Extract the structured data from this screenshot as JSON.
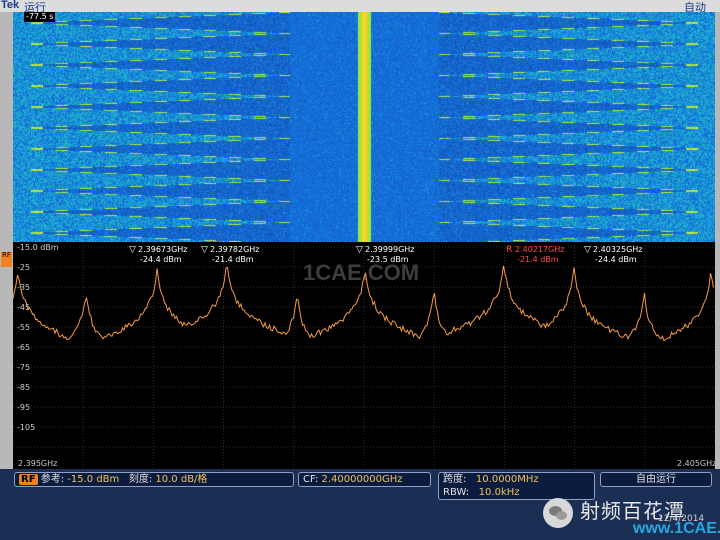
{
  "header": {
    "brand": "Tek",
    "run_state": "运行",
    "mode": "自动"
  },
  "waterfall": {
    "time_label": "-77.5 s"
  },
  "markers": [
    {
      "freq": "2.39673GHz",
      "level": "-24.4 dBm",
      "ref": false
    },
    {
      "freq": "2.39782GHz",
      "level": "-21.4 dBm",
      "ref": false
    },
    {
      "freq": "2.39999GHz",
      "level": "-23.5 dBm",
      "ref": false
    },
    {
      "freq": "2.40217GHz",
      "level": "-21.4 dBm",
      "ref": true
    },
    {
      "freq": "2.40325GHz",
      "level": "-24.4 dBm",
      "ref": false
    }
  ],
  "spectrum": {
    "y_tick_labels": [
      "-15.0 dBm",
      "-25",
      "-35",
      "-45",
      "-55",
      "-65",
      "-75",
      "-85",
      "-95",
      "-105"
    ],
    "x_start": "2.395GHz",
    "x_end": "2.405GHz",
    "watermark": "1CAE.COM",
    "trace_color": "#f59a45"
  },
  "status": {
    "rf_badge": "RF",
    "ref_label": "参考:",
    "ref_value": "-15.0 dBm",
    "scale_label": "刻度:",
    "scale_value": "10.0 dB/格",
    "cf_label": "CF:",
    "cf_value": "2.40000000GHz",
    "span_label": "跨度:",
    "span_value": "10.0000MHz",
    "rbw_label": "RBW:",
    "rbw_value": "10.0kHz",
    "run_mode": "自由运行"
  },
  "watermark_overlay": {
    "channel_name": "射频百花潭",
    "site": "www.1CAE.com",
    "date": "12/4/2014"
  },
  "rf_left_badge": "RF"
}
